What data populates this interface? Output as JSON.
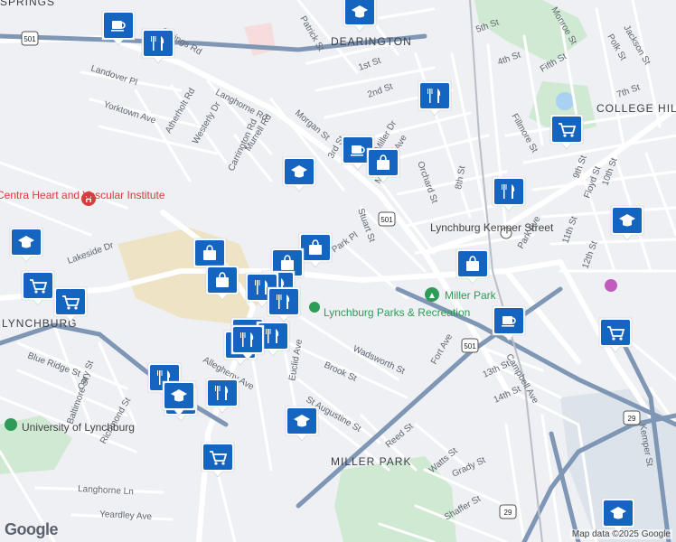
{
  "map": {
    "attribution": "Map data ©2025 Google",
    "logo": "Google",
    "areas": [
      {
        "name": "DEARINGTON"
      },
      {
        "name": "COLLEGE HILL"
      },
      {
        "name": "LYNCHBURG"
      },
      {
        "name": "MILLER PARK"
      },
      {
        "name": "SPRINGS"
      }
    ],
    "places": [
      {
        "name": "Lynchburg Parks & Recreation",
        "color": "#2e9b57"
      },
      {
        "name": "Miller Park",
        "color": "#2e9b57"
      },
      {
        "name": "Lynchburg Kemper Street",
        "color": "#444"
      },
      {
        "name": "University of Lynchburg",
        "color": "#444"
      },
      {
        "name": "Centra Heart and Vascular Institute",
        "color": "#d93c3c"
      }
    ],
    "route_shields": [
      "501",
      "501",
      "501",
      "29",
      "29"
    ],
    "streets": [
      "Patrick St",
      "1st St",
      "2nd St",
      "3rd St",
      "4th St",
      "5th St",
      "7th St",
      "8th St",
      "9th St",
      "10th St",
      "11th St",
      "12th St",
      "13th St",
      "14th St",
      "Fifth St",
      "Monroe St",
      "Polk St",
      "Jackson St",
      "Park Ave",
      "Fillmore St",
      "Floyd St",
      "Landover Pl",
      "Yorktown Ave",
      "Atherholt Rd",
      "Westerly Dr",
      "Langhorne Rd",
      "Carrington Rd",
      "Murrell Rd",
      "Morgan St",
      "Memorial Ave",
      "Orchard St",
      "Stuart St",
      "Park Pl",
      "Lakeside Dr",
      "Wadsworth St",
      "Brook St",
      "Euclid Ave",
      "Fort Ave",
      "Campbell Ave",
      "Kemper St",
      "Blue Ridge St",
      "Cary St",
      "Baltimore St",
      "Richmond St",
      "Allegheny Ave",
      "St Augustine St",
      "Reed St",
      "Watts St",
      "Grady St",
      "Langhorne Ln",
      "Yeardley Ave",
      "Shaffer St",
      "Miller Dr",
      "Springs Rd"
    ],
    "markers": [
      {
        "type": "cafe",
        "icon": "coffee-icon"
      },
      {
        "type": "restaurant",
        "icon": "fork-knife-icon"
      },
      {
        "type": "school",
        "icon": "graduation-cap-icon"
      },
      {
        "type": "restaurant",
        "icon": "fork-knife-icon"
      },
      {
        "type": "cafe",
        "icon": "coffee-icon"
      },
      {
        "type": "shopping",
        "icon": "shopping-bag-icon"
      },
      {
        "type": "school",
        "icon": "graduation-cap-icon"
      },
      {
        "type": "grocery",
        "icon": "shopping-cart-icon"
      },
      {
        "type": "restaurant",
        "icon": "fork-knife-icon"
      },
      {
        "type": "school",
        "icon": "graduation-cap-icon"
      },
      {
        "type": "shopping",
        "icon": "shopping-bag-icon"
      },
      {
        "type": "shopping",
        "icon": "shopping-bag-icon"
      },
      {
        "type": "shopping",
        "icon": "shopping-bag-icon"
      },
      {
        "type": "shopping",
        "icon": "shopping-bag-icon"
      },
      {
        "type": "shopping",
        "icon": "shopping-bag-icon"
      },
      {
        "type": "restaurant",
        "icon": "fork-knife-icon"
      },
      {
        "type": "restaurant",
        "icon": "fork-knife-icon"
      },
      {
        "type": "restaurant",
        "icon": "fork-knife-icon"
      },
      {
        "type": "school",
        "icon": "graduation-cap-icon"
      },
      {
        "type": "grocery",
        "icon": "shopping-cart-icon"
      },
      {
        "type": "grocery",
        "icon": "shopping-cart-icon"
      },
      {
        "type": "cafe",
        "icon": "coffee-icon"
      },
      {
        "type": "grocery",
        "icon": "shopping-cart-icon"
      },
      {
        "type": "restaurant",
        "icon": "fork-knife-icon"
      },
      {
        "type": "restaurant",
        "icon": "fork-knife-icon"
      },
      {
        "type": "restaurant",
        "icon": "fork-knife-icon"
      },
      {
        "type": "restaurant",
        "icon": "fork-knife-icon"
      },
      {
        "type": "restaurant",
        "icon": "fork-knife-icon"
      },
      {
        "type": "restaurant",
        "icon": "fork-knife-icon"
      },
      {
        "type": "school",
        "icon": "graduation-cap-icon"
      },
      {
        "type": "grocery",
        "icon": "shopping-cart-icon"
      },
      {
        "type": "school",
        "icon": "graduation-cap-icon"
      },
      {
        "type": "restaurant",
        "icon": "fork-knife-icon"
      },
      {
        "type": "school",
        "icon": "graduation-cap-icon"
      }
    ],
    "colors": {
      "marker_fill": "#1565c0",
      "marker_border": "#ffffff",
      "highway": "#7f97b5",
      "park": "#cfe9d2",
      "land": "#eef0f3",
      "road": "#ffffff",
      "rail": "#b9bec7"
    }
  }
}
